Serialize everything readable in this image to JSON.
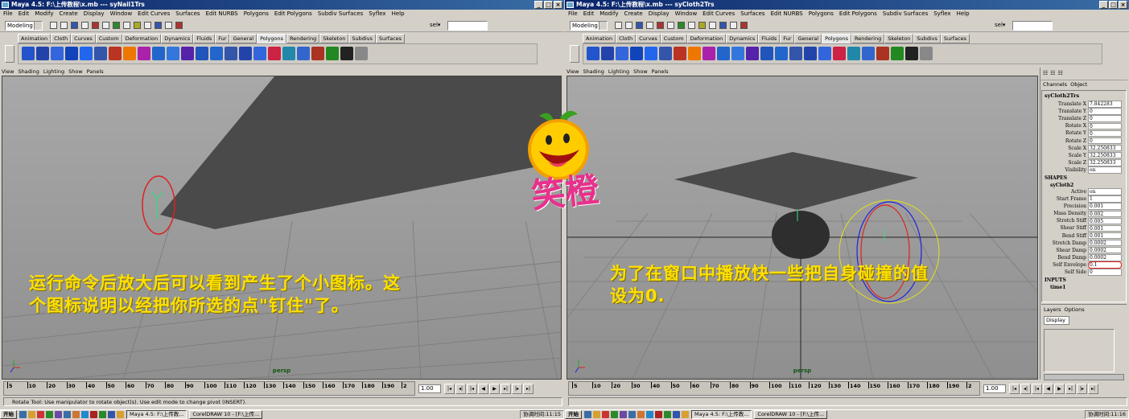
{
  "left": {
    "title": "Maya 4.5: F:\\上传教程\\x.mb  ---  syNail1Trs",
    "menu": [
      "File",
      "Edit",
      "Modify",
      "Create",
      "Display",
      "Window",
      "Edit Curves",
      "Surfaces",
      "Edit NURBS",
      "Polygons",
      "Edit Polygons",
      "Subdiv Surfaces",
      "Syflex",
      "Help"
    ],
    "mode": "Modeling",
    "sel_label": "sel▾",
    "shelf_tabs": [
      "Animation",
      "Cloth",
      "Curves",
      "Custom",
      "Deformation",
      "Dynamics",
      "Fluids",
      "Fur",
      "General",
      "Polygons",
      "Rendering",
      "Skeleton",
      "Subdivs",
      "Surfaces"
    ],
    "active_tab": "Polygons",
    "viewport_menu": [
      "View",
      "Shading",
      "Lighting",
      "Show",
      "Panels"
    ],
    "camera": "persp",
    "overlay_lines": [
      "运行命令后放大后可以看到产生了个小图标。这",
      "个图标说明以经把你所选的点\"钉住\"了。"
    ],
    "ticks": [
      "5",
      "10",
      "20",
      "30",
      "40",
      "50",
      "60",
      "70",
      "80",
      "90",
      "100",
      "110",
      "120",
      "130",
      "140",
      "150",
      "160",
      "170",
      "180",
      "190",
      "2"
    ],
    "current_frame": "1.00",
    "help": "Rotate Tool: Use manipulator to rotate object(s). Use edit mode to change pivot (INSERT).",
    "taskbar": {
      "start": "开始",
      "tasks": [
        "Maya 4.5: F:\\上传教...",
        "CorelDRAW 10 - [F:\\上传..."
      ],
      "clock": "协调时间:11:15"
    }
  },
  "right": {
    "title": "Maya 4.5: F:\\上传教程\\x.mb  ---  syCloth2Trs",
    "menu": [
      "File",
      "Edit",
      "Modify",
      "Create",
      "Display",
      "Window",
      "Edit Curves",
      "Surfaces",
      "Edit NURBS",
      "Polygons",
      "Edit Polygons",
      "Subdiv Surfaces",
      "Syflex",
      "Help"
    ],
    "mode": "Modeling",
    "sel_label": "sel▾",
    "shelf_tabs": [
      "Animation",
      "Cloth",
      "Curves",
      "Custom",
      "Deformation",
      "Dynamics",
      "Fluids",
      "Fur",
      "General",
      "Polygons",
      "Rendering",
      "Skeleton",
      "Subdivs",
      "Surfaces"
    ],
    "active_tab": "Polygons",
    "viewport_menu": [
      "View",
      "Shading",
      "Lighting",
      "Show",
      "Panels"
    ],
    "camera": "persp",
    "overlay_lines": [
      "为了在窗口中播放快一些把自身碰撞的值",
      "设为0."
    ],
    "ticks": [
      "5",
      "10",
      "20",
      "30",
      "40",
      "50",
      "60",
      "70",
      "80",
      "90",
      "100",
      "110",
      "120",
      "130",
      "140",
      "150",
      "160",
      "170",
      "180",
      "190",
      "2"
    ],
    "current_frame": "1.00",
    "taskbar": {
      "start": "开始",
      "tasks": [
        "Maya 4.5: F:\\上传教...",
        "CorelDRAW 10 - [F:\\上传..."
      ],
      "clock": "协调时间:11:16"
    },
    "channel_box": {
      "menu": [
        "Channels",
        "Object"
      ],
      "object": "syCloth2Trs",
      "transform": [
        {
          "label": "Translate X",
          "value": "7.842283"
        },
        {
          "label": "Translate Y",
          "value": "0"
        },
        {
          "label": "Translate Z",
          "value": "0"
        },
        {
          "label": "Rotate X",
          "value": "0"
        },
        {
          "label": "Rotate Y",
          "value": "0"
        },
        {
          "label": "Rotate Z",
          "value": "0"
        },
        {
          "label": "Scale X",
          "value": "32.250833"
        },
        {
          "label": "Scale Y",
          "value": "32.250833"
        },
        {
          "label": "Scale Z",
          "value": "32.250833"
        },
        {
          "label": "Visibility",
          "value": "on"
        }
      ],
      "shapes_header": "SHAPES",
      "shape_name": "syCloth2",
      "shape_attrs": [
        {
          "label": "Active",
          "value": "on"
        },
        {
          "label": "Start Frame",
          "value": "1"
        },
        {
          "label": "Precision",
          "value": "0.001"
        },
        {
          "label": "Mass Density",
          "value": "0.002"
        },
        {
          "label": "Stretch Stiff",
          "value": "0.005"
        },
        {
          "label": "Shear Stiff",
          "value": "0.001"
        },
        {
          "label": "Bend Stiff",
          "value": "0.001"
        },
        {
          "label": "Stretch Damp",
          "value": "0.0002"
        },
        {
          "label": "Shear Damp",
          "value": "0.0002"
        },
        {
          "label": "Bend Damp",
          "value": "0.0002"
        },
        {
          "label": "Self Envelope",
          "value": "0.1"
        },
        {
          "label": "Self Side",
          "value": "0"
        }
      ],
      "inputs_header": "INPUTS",
      "input_name": "time1",
      "layers_menu": [
        "Layers",
        "Options"
      ],
      "layers_display": "Display"
    }
  },
  "logo_text": "笑橙",
  "colors": {
    "overlay": "#ffe000",
    "logo_text": "#e8308c",
    "title_blue": "#0a246a"
  }
}
